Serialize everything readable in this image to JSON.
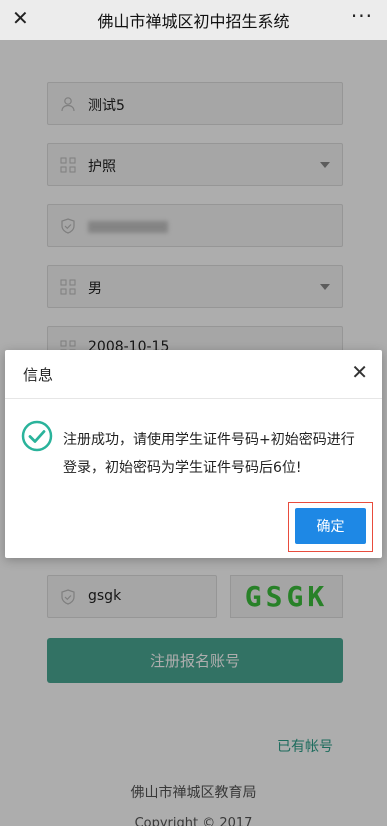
{
  "topbar": {
    "close_glyph": "✕",
    "title": "佛山市禅城区初中招生系统",
    "more_glyph": "···"
  },
  "form": {
    "name_value": "测试5",
    "id_type_value": "护照",
    "gender_value": "男",
    "birthdate_value": "2008-10-15",
    "captcha_input_value": "gsgk",
    "captcha_image_text": "GSGK",
    "submit_label": "注册报名账号",
    "login_link": "已有帐号"
  },
  "footer": {
    "org": "佛山市禅城区教育局",
    "copyright": "Copyright © 2017"
  },
  "dialog": {
    "title": "信息",
    "close_glyph": "✕",
    "message": "注册成功，请使用学生证件号码+初始密码进行登录，初始密码为学生证件号码后6位!",
    "confirm_label": "确定"
  },
  "icons": {
    "user": "user-icon",
    "grid": "grid-icon",
    "shield": "shield-icon",
    "check": "check-circle-icon"
  },
  "colors": {
    "primary_green": "#4aa894",
    "confirm_blue": "#1e88e5",
    "highlight_red": "#e84c3d",
    "captcha_green": "#3bbf3b"
  }
}
